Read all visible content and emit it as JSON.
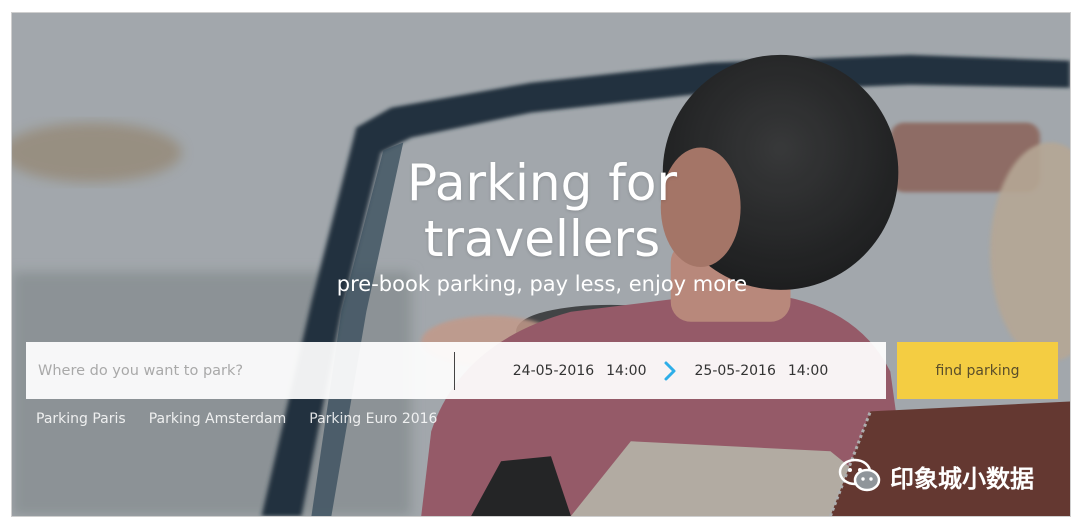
{
  "hero": {
    "title_line1": "Parking for",
    "title_line2": "travellers",
    "subtitle": "pre-book parking, pay less, enjoy more"
  },
  "search": {
    "placeholder": "Where do you want to park?",
    "start_date": "24-05-2016",
    "start_time": "14:00",
    "end_date": "25-05-2016",
    "end_time": "14:00",
    "button_label": "find parking"
  },
  "quick_links": [
    "Parking Paris",
    "Parking Amsterdam",
    "Parking Euro 2016"
  ],
  "watermark": {
    "text": "印象城小数据",
    "icon": "wechat-icon"
  },
  "colors": {
    "accent": "#f4cd42",
    "chevron": "#2eaee8",
    "hero_text": "#ffffff"
  }
}
